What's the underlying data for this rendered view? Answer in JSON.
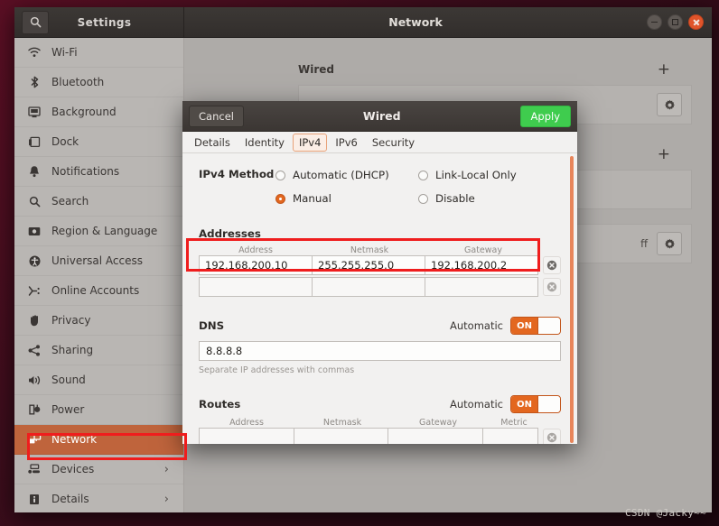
{
  "window": {
    "app_title": "Settings",
    "panel_title": "Network",
    "search_icon": "search-icon",
    "buttons": {
      "minimize": "minimize",
      "maximize": "maximize",
      "close": "close"
    }
  },
  "sidebar": {
    "items": [
      {
        "label": "Wi-Fi",
        "icon": "wifi-icon",
        "selected": false,
        "chevron": ""
      },
      {
        "label": "Bluetooth",
        "icon": "bluetooth-icon",
        "selected": false,
        "chevron": ""
      },
      {
        "label": "Background",
        "icon": "background-icon",
        "selected": false,
        "chevron": ""
      },
      {
        "label": "Dock",
        "icon": "dock-icon",
        "selected": false,
        "chevron": ""
      },
      {
        "label": "Notifications",
        "icon": "bell-icon",
        "selected": false,
        "chevron": ""
      },
      {
        "label": "Search",
        "icon": "search-icon",
        "selected": false,
        "chevron": ""
      },
      {
        "label": "Region & Language",
        "icon": "region-language-icon",
        "selected": false,
        "chevron": ""
      },
      {
        "label": "Universal Access",
        "icon": "accessibility-icon",
        "selected": false,
        "chevron": ""
      },
      {
        "label": "Online Accounts",
        "icon": "online-accounts-icon",
        "selected": false,
        "chevron": ""
      },
      {
        "label": "Privacy",
        "icon": "hand-icon",
        "selected": false,
        "chevron": ""
      },
      {
        "label": "Sharing",
        "icon": "share-icon",
        "selected": false,
        "chevron": ""
      },
      {
        "label": "Sound",
        "icon": "speaker-icon",
        "selected": false,
        "chevron": ""
      },
      {
        "label": "Power",
        "icon": "power-icon",
        "selected": false,
        "chevron": ""
      },
      {
        "label": "Network",
        "icon": "network-icon",
        "selected": true,
        "chevron": ""
      },
      {
        "label": "Devices",
        "icon": "devices-icon",
        "selected": false,
        "chevron": "›"
      },
      {
        "label": "Details",
        "icon": "info-icon",
        "selected": false,
        "chevron": "›"
      }
    ]
  },
  "network_panel": {
    "sections": [
      {
        "title": "Wired",
        "add_label": "+",
        "status": "",
        "gear": "gear-icon"
      },
      {
        "title": "",
        "add_label": "+",
        "status": "",
        "gear": ""
      },
      {
        "title": "",
        "add_label": "",
        "status": "ff",
        "gear": "gear-icon"
      }
    ]
  },
  "dialog": {
    "title": "Wired",
    "cancel_label": "Cancel",
    "apply_label": "Apply",
    "tabs": [
      {
        "label": "Details",
        "active": false
      },
      {
        "label": "Identity",
        "active": false
      },
      {
        "label": "IPv4",
        "active": true
      },
      {
        "label": "IPv6",
        "active": false
      },
      {
        "label": "Security",
        "active": false
      }
    ],
    "ipv4_method": {
      "label": "IPv4 Method",
      "options": [
        {
          "label": "Automatic (DHCP)",
          "selected": false
        },
        {
          "label": "Manual",
          "selected": true
        },
        {
          "label": "Link-Local Only",
          "selected": false
        },
        {
          "label": "Disable",
          "selected": false
        }
      ]
    },
    "addresses": {
      "label": "Addresses",
      "columns": [
        "Address",
        "Netmask",
        "Gateway"
      ],
      "rows": [
        {
          "address": "192.168.200.10",
          "netmask": "255.255.255.0",
          "gateway": "192.168.200.2"
        },
        {
          "address": "",
          "netmask": "",
          "gateway": ""
        }
      ],
      "delete_icon": "remove-circle-icon"
    },
    "dns": {
      "label": "DNS",
      "automatic_label": "Automatic",
      "toggle_state": "ON",
      "value": "8.8.8.8",
      "hint": "Separate IP addresses with commas"
    },
    "routes": {
      "label": "Routes",
      "automatic_label": "Automatic",
      "toggle_state": "ON",
      "columns": [
        "Address",
        "Netmask",
        "Gateway",
        "Metric"
      ],
      "rows": [
        {
          "address": "",
          "netmask": "",
          "gateway": "",
          "metric": ""
        }
      ],
      "delete_icon": "remove-circle-icon"
    }
  },
  "annotations": {
    "accent_red": "#ef1d1d",
    "accent_orange": "#e3671f",
    "apply_green": "#3fcc4e"
  },
  "watermark": "CSDN @Jacky~~"
}
